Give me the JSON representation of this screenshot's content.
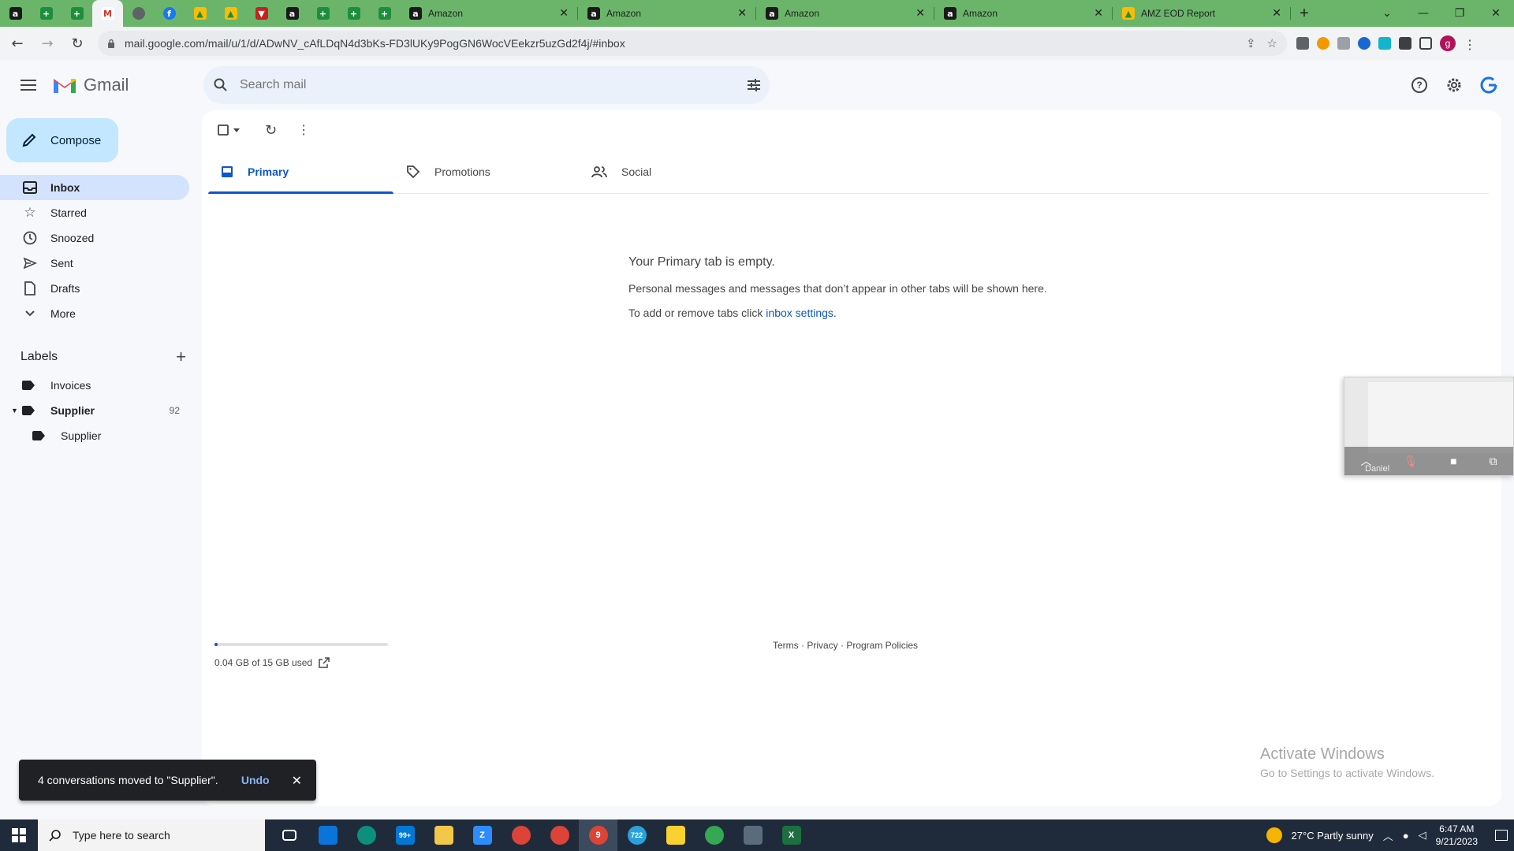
{
  "browser": {
    "pinned_tabs": [
      {
        "icon": "amazon-icon",
        "glyph": "a",
        "cls": "amz"
      },
      {
        "icon": "sheets-icon",
        "glyph": "+",
        "cls": "sheet"
      },
      {
        "icon": "sheets-icon",
        "glyph": "+",
        "cls": "sheet"
      },
      {
        "icon": "gmail-icon",
        "glyph": "M",
        "cls": "gm"
      },
      {
        "icon": "globe-icon",
        "glyph": "",
        "cls": "grey"
      },
      {
        "icon": "facebook-icon",
        "glyph": "f",
        "cls": "fb"
      },
      {
        "icon": "drive-icon",
        "glyph": "▲",
        "cls": "drive"
      },
      {
        "icon": "drive-icon",
        "glyph": "▲",
        "cls": "drive"
      },
      {
        "icon": "red-v-icon",
        "glyph": "▼",
        "cls": "red"
      },
      {
        "icon": "amazon-icon",
        "glyph": "a",
        "cls": "amz"
      },
      {
        "icon": "sheets-icon",
        "glyph": "+",
        "cls": "sheet"
      },
      {
        "icon": "sheets-icon",
        "glyph": "+",
        "cls": "sheet"
      },
      {
        "icon": "sheets-icon",
        "glyph": "+",
        "cls": "sheet"
      }
    ],
    "tabs": [
      {
        "title": "Amazon"
      },
      {
        "title": "Amazon"
      },
      {
        "title": "Amazon"
      },
      {
        "title": "Amazon"
      },
      {
        "title": "AMZ EOD Report"
      }
    ],
    "url": "mail.google.com/mail/u/1/d/ADwNV_cAfLDqN4d3bKs-FD3lUKy9PogGN6WocVEekzr5uzGd2f4j/#inbox",
    "profile_initial": "g"
  },
  "gmail": {
    "logo_text": "Gmail",
    "search_placeholder": "Search mail",
    "compose_label": "Compose",
    "nav": [
      {
        "label": "Inbox",
        "icon": "inbox-icon"
      },
      {
        "label": "Starred",
        "icon": "star-icon"
      },
      {
        "label": "Snoozed",
        "icon": "clock-icon"
      },
      {
        "label": "Sent",
        "icon": "send-icon"
      },
      {
        "label": "Drafts",
        "icon": "draft-icon"
      },
      {
        "label": "More",
        "icon": "chevron-down-icon"
      }
    ],
    "labels_heading": "Labels",
    "labels": [
      {
        "label": "Invoices",
        "count": ""
      },
      {
        "label": "Supplier",
        "count": "92"
      },
      {
        "label": "Supplier",
        "count": ""
      }
    ],
    "tabs": [
      {
        "label": "Primary"
      },
      {
        "label": "Promotions"
      },
      {
        "label": "Social"
      }
    ],
    "empty_title": "Your Primary tab is empty.",
    "empty_line1": "Personal messages and messages that don’t appear in other tabs will be shown here.",
    "empty_line2_prefix": "To add or remove tabs click ",
    "empty_link": "inbox settings",
    "empty_line2_suffix": ".",
    "storage_text": "0.04 GB of 15 GB used",
    "storage_fraction": 0.003,
    "footer": "Terms · Privacy · Program Policies",
    "snackbar": {
      "message": "4 conversations moved to \"Supplier\".",
      "undo": "Undo"
    }
  },
  "video_overlay": {
    "name": "Daniel"
  },
  "watermark": {
    "line1": "Activate Windows",
    "line2": "Go to Settings to activate Windows."
  },
  "taskbar": {
    "search_placeholder": "Type here to search",
    "weather": "27°C  Partly sunny",
    "time": "6:47 AM",
    "date": "9/21/2023",
    "badges": {
      "mail": "99+",
      "chrome": "9",
      "telegram": "722"
    }
  }
}
